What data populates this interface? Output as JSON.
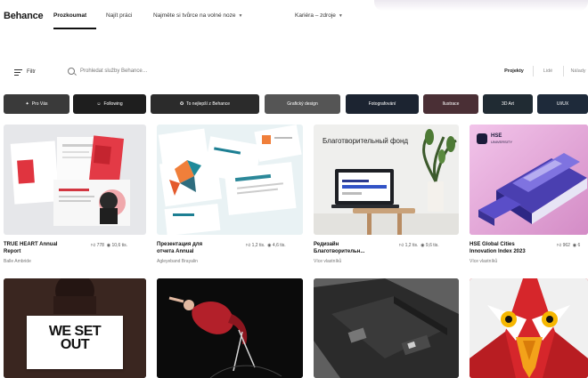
{
  "brand": {
    "logo": "Behance"
  },
  "nav": {
    "items": [
      {
        "label": "Prozkoumat",
        "active": true
      },
      {
        "label": "Najít práci",
        "active": false
      },
      {
        "label": "Najměte si tvůrce na volné noze",
        "active": false,
        "dropdown": true
      },
      {
        "label": "Kariéra – zdroje",
        "active": false,
        "dropdown": true
      }
    ]
  },
  "toolbar": {
    "filter_label": "Filtr",
    "search_placeholder": "Prohledat služby Behance…",
    "view_options": [
      "Projekty",
      "Lidé",
      "Nálady"
    ],
    "selected_view": "Projekty"
  },
  "chips": [
    {
      "label": "Pro Vás",
      "color": "#3a3a3a"
    },
    {
      "label": "Following",
      "color": "#1e1e1e"
    },
    {
      "label": "To nejlepší z Behance",
      "color": "#2b2b2b"
    },
    {
      "label": "Grafický design",
      "color": "#555555"
    },
    {
      "label": "Fotografování",
      "color": "#1c2431"
    },
    {
      "label": "Ilustrace",
      "color": "#4a2f35"
    },
    {
      "label": "3D Art",
      "color": "#202b33"
    },
    {
      "label": "UI/UX",
      "color": "#1e2a3a"
    }
  ],
  "projects": [
    {
      "title_lines": [
        "TRUE HEART Annual",
        "Report"
      ],
      "owner": "Balle Ambride",
      "appreciations": "778",
      "views": "10,6 tis."
    },
    {
      "title_lines": [
        "Презентация для",
        "отчета Annual"
      ],
      "owner": "Agleyeband Brayalin",
      "appreciations": "1,2 tis.",
      "views": "4,6 tis."
    },
    {
      "title_lines": [
        "Редизайн",
        "Благотворительн..."
      ],
      "owner": "Více vlastníků",
      "appreciations": "1,2 tis.",
      "views": "9,6 tis."
    },
    {
      "title_lines": [
        "HSE Global Cities",
        "Innovation Index 2023"
      ],
      "owner": "Více vlastníků",
      "appreciations": "962",
      "views": "6"
    },
    {
      "title_lines": [],
      "owner": "",
      "appreciations": "",
      "views": ""
    },
    {
      "title_lines": [],
      "owner": "",
      "appreciations": "",
      "views": ""
    },
    {
      "title_lines": [],
      "owner": "",
      "appreciations": "",
      "views": ""
    },
    {
      "title_lines": [],
      "owner": "",
      "appreciations": "",
      "views": ""
    }
  ],
  "thumb_text": {
    "charity_heading": "Благотворительный фонд",
    "hse_logo": "HSE",
    "hse_sub": "UNIVERSITY",
    "we_set_out": [
      "WE SET",
      "OUT"
    ]
  },
  "colors": {
    "accent": "#1769ff",
    "text": "#191919",
    "muted": "#777777"
  }
}
